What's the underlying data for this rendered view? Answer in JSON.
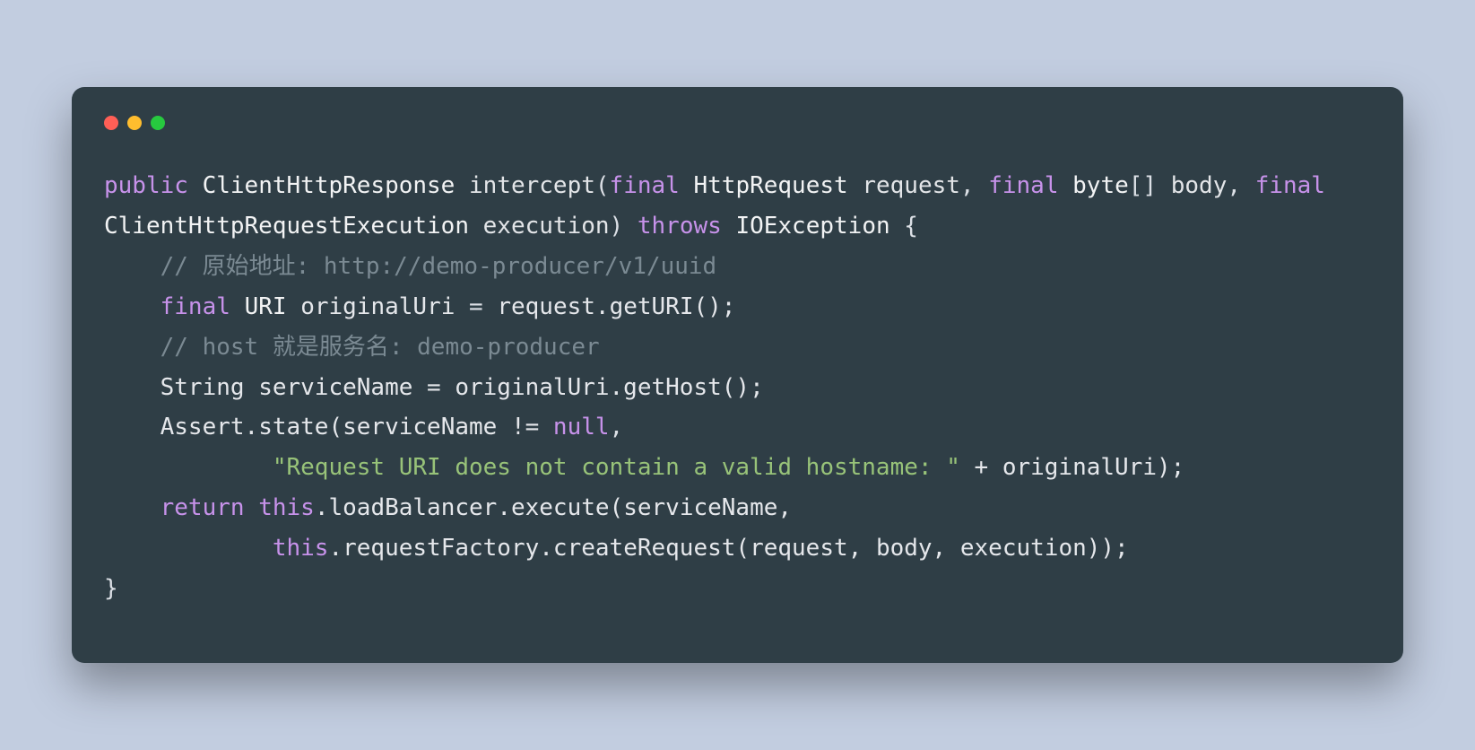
{
  "colors": {
    "background": "#c2cde0",
    "window": "#2f3e46",
    "dotRed": "#ff5f56",
    "dotYellow": "#ffbd2e",
    "dotGreen": "#27c93f",
    "keyword": "#c792ea",
    "comment": "#7b8a93",
    "string": "#98c379",
    "text": "#e5e7eb"
  },
  "code": {
    "line1": {
      "kw_public": "public",
      "type_ClientHttpResponse": "ClientHttpResponse",
      "func_intercept": "intercept",
      "paren_open": "(",
      "kw_final1": "final",
      "type_HttpRequest": "HttpRequest",
      "param_request": "request",
      "comma1": ",",
      "kw_final2": "final",
      "type_byte": "byte",
      "brackets": "[]",
      "param_body": "body",
      "comma2": ",",
      "kw_final3": "final",
      "type_ClientHttpRequestExecution": "ClientHttpRequestExecution",
      "param_execution": "execution",
      "paren_close": ")",
      "kw_throws": "throws",
      "type_IOException": "IOException",
      "brace_open": "{"
    },
    "line2_comment": "// 原始地址: http://demo-producer/v1/uuid",
    "line3": {
      "kw_final": "final",
      "type_URI": "URI",
      "var_originalUri": "originalUri",
      "eq": "=",
      "expr": "request.getURI();"
    },
    "line4_comment": "// host 就是服务名: demo-producer",
    "line5": "String serviceName = originalUri.getHost();",
    "line6": {
      "pre": "Assert.state(serviceName != ",
      "null": "null",
      "post": ","
    },
    "line7": {
      "str": "\"Request URI does not contain a valid hostname: \"",
      "post": " + originalUri);"
    },
    "line8": {
      "kw_return": "return",
      "this": "this",
      "post": ".loadBalancer.execute(serviceName,"
    },
    "line9": {
      "this": "this",
      "post": ".requestFactory.createRequest(request, body, execution));"
    },
    "line10_brace": "}"
  }
}
